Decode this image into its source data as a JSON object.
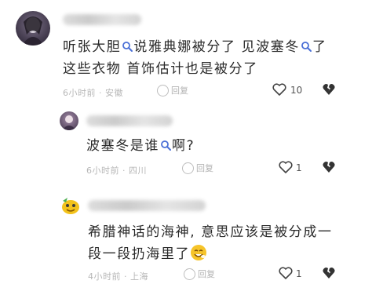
{
  "comments": [
    {
      "text_lines": [
        [
          "听张大胆",
          "search",
          "说雅典娜被分了 见波塞冬",
          "search",
          "了"
        ],
        [
          "这些衣物 首饰估计也是被分了"
        ]
      ],
      "meta": "6小时前 · 安徽",
      "reply_label": "回复",
      "like_count": "10"
    },
    {
      "text_lines": [
        [
          "波塞冬是谁",
          "search",
          "啊?"
        ]
      ],
      "meta": "6小时前 · 四川",
      "reply_label": "回复",
      "like_count": "1"
    },
    {
      "text_lines": [
        [
          "希腊神话的海神, 意思应该是被分成一"
        ],
        [
          "段一段扔海里了",
          "emoji"
        ]
      ],
      "meta": "4小时前 · 上海",
      "reply_label": "回复",
      "like_count": "1"
    }
  ],
  "colors": {
    "search_icon": "#4a6fd6",
    "text": "#2a2a2a",
    "meta": "#b7b7b7"
  },
  "icons": {
    "search": "search-icon",
    "like": "heart-icon",
    "dislike": "broken-heart-icon",
    "reply": "reply-icon",
    "emoji": "smiley-emoji-icon"
  }
}
